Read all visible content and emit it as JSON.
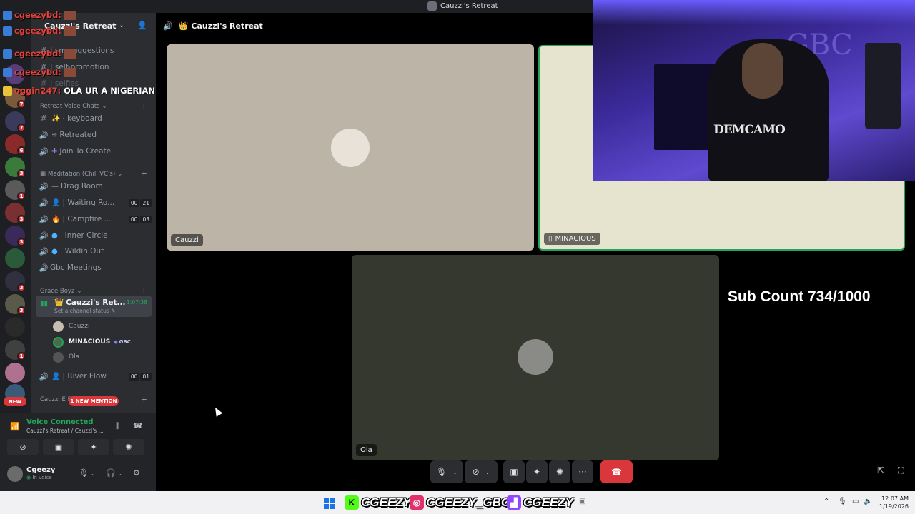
{
  "window": {
    "title": "Cauzzi's Retreat"
  },
  "server": {
    "name": "Cauzzi's Retreat"
  },
  "overlay": {
    "lines": [
      {
        "name": "cgeezybd:",
        "msg": ""
      },
      {
        "name": "cgeezybd:",
        "msg": ""
      },
      {
        "name": "cgeezybd:",
        "msg": ""
      },
      {
        "name": "cgeezybd:",
        "msg": ""
      },
      {
        "name": "cgeezybd:",
        "msg": ""
      },
      {
        "name": "oggin247:",
        "msg": "OLA UR A NIGERIAN"
      }
    ]
  },
  "channels_top": [
    {
      "label": "| sm-suggestions"
    },
    {
      "label": "| self-promotion"
    },
    {
      "label": "| selfies"
    }
  ],
  "categories": {
    "retreat_voice": "Retreat Voice Chats",
    "meditation": "Meditation (Chill VC's)",
    "grace_boyz": "Grace Boyz",
    "cauzzi_e": "Cauzzi E D"
  },
  "voice_channels": [
    {
      "label": "· keyboard",
      "icon": "hash"
    },
    {
      "label": "Retreated",
      "icon": "speaker"
    },
    {
      "label": "Join To Create",
      "icon": "speaker"
    },
    {
      "label": "Drag Room",
      "icon": "speaker"
    },
    {
      "label": "| Waiting Ro...",
      "icon": "speaker",
      "count_a": "00",
      "count_b": "21"
    },
    {
      "label": "| Campfire ...",
      "icon": "speaker",
      "count_a": "00",
      "count_b": "03"
    },
    {
      "label": "| Inner Circle",
      "icon": "speaker"
    },
    {
      "label": "| Wildin Out",
      "icon": "speaker"
    },
    {
      "label": "Gbc Meetings",
      "icon": "speaker"
    }
  ],
  "active_channel": {
    "name": "Cauzzi's Ret...",
    "status": "Set a channel status",
    "time": "1:07:38",
    "members": [
      {
        "name": "Cauzzi"
      },
      {
        "name": "MINACIOUS",
        "tag": "GBC"
      },
      {
        "name": "Ola"
      }
    ]
  },
  "river_flow": {
    "label": "| River Flow",
    "count_a": "00",
    "count_b": "01"
  },
  "mention_pill": "1 NEW MENTION",
  "new_pill": "NEW",
  "voice_panel": {
    "status": "Voice Connected",
    "location": "Cauzzi's Retreat / Cauzzi's ..."
  },
  "user": {
    "name": "Cgeezy",
    "status": "In voice"
  },
  "header": {
    "title": "Cauzzi's Retreat"
  },
  "tiles": {
    "cauzzi": "Cauzzi",
    "minacious": "MINACIOUS",
    "ola": "Ola"
  },
  "cam": {
    "hoodie_text": "DEMCAMO",
    "sign": "GBC"
  },
  "subcount": "Sub Count 734/1000",
  "socials": [
    {
      "handle": "CGEEZY",
      "platform": "kick",
      "color": "#53fc18"
    },
    {
      "handle": "CGEEZY_GBC",
      "platform": "instagram",
      "color": "#e1306c"
    },
    {
      "handle": "CGEEZY",
      "platform": "twitch",
      "color": "#9146ff"
    }
  ],
  "clock": {
    "time": "12:07 AM",
    "date": "1/19/2026"
  },
  "colors": {
    "accent_green": "#23a55a",
    "danger": "#da373c",
    "sidebar": "#2b2d31"
  }
}
